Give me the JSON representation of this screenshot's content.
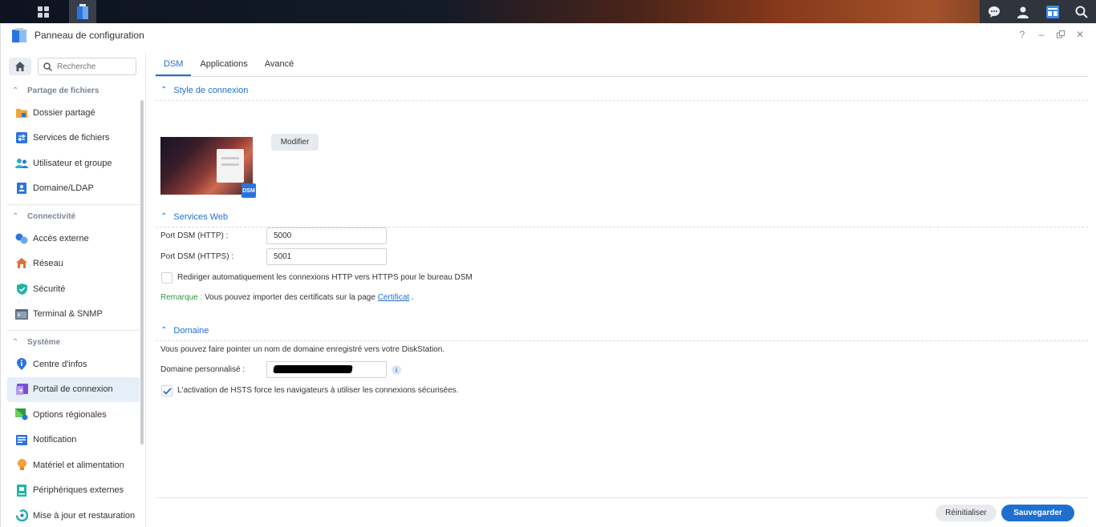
{
  "taskbar": {
    "left_icons": [
      "grid-icon",
      "control-panel-icon"
    ],
    "right_icons": [
      "chat-icon",
      "user-icon",
      "widgets-icon",
      "search-icon"
    ]
  },
  "window": {
    "title": "Panneau de configuration",
    "controls": [
      "?",
      "–",
      "□",
      "✕"
    ]
  },
  "sidebar": {
    "search_placeholder": "Recherche",
    "groups": [
      {
        "label": "Partage de fichiers",
        "items": [
          {
            "label": "Dossier partagé",
            "icon": "folder-share-icon",
            "color": "#f2a33a"
          },
          {
            "label": "Services de fichiers",
            "icon": "file-services-icon",
            "color": "#2b74e0"
          },
          {
            "label": "Utilisateur et groupe",
            "icon": "users-icon",
            "color": "#25b0c6"
          },
          {
            "label": "Domaine/LDAP",
            "icon": "domain-icon",
            "color": "#2b74e0"
          }
        ]
      },
      {
        "label": "Connectivité",
        "items": [
          {
            "label": "Accès externe",
            "icon": "external-access-icon",
            "color": "#2b74e0"
          },
          {
            "label": "Réseau",
            "icon": "network-icon",
            "color": "#e2703a"
          },
          {
            "label": "Sécurité",
            "icon": "shield-icon",
            "color": "#1fb5a6"
          },
          {
            "label": "Terminal & SNMP",
            "icon": "terminal-icon",
            "color": "#5a6a7d"
          }
        ]
      },
      {
        "label": "Système",
        "items": [
          {
            "label": "Centre d'infos",
            "icon": "info-center-icon",
            "color": "#2b74e0"
          },
          {
            "label": "Portail de connexion",
            "icon": "login-portal-icon",
            "color": "#7a4fd6",
            "selected": true
          },
          {
            "label": "Options régionales",
            "icon": "regional-icon",
            "color": "#2e9a3a"
          },
          {
            "label": "Notification",
            "icon": "notification-icon",
            "color": "#2b74e0"
          },
          {
            "label": "Matériel et alimentation",
            "icon": "bulb-icon",
            "color": "#f2a33a"
          },
          {
            "label": "Périphériques externes",
            "icon": "external-devices-icon",
            "color": "#1fb5a6"
          },
          {
            "label": "Mise à jour et restauration",
            "icon": "update-icon",
            "color": "#1fb5a6"
          }
        ]
      }
    ]
  },
  "tabs": [
    {
      "label": "DSM",
      "active": true
    },
    {
      "label": "Applications",
      "active": false
    },
    {
      "label": "Avancé",
      "active": false
    }
  ],
  "login_style": {
    "heading": "Style de connexion",
    "badge": "DSM",
    "modify_label": "Modifier"
  },
  "web_services": {
    "heading": "Services Web",
    "http_label": "Port DSM (HTTP) :",
    "http_value": "5000",
    "https_label": "Port DSM (HTTPS) :",
    "https_value": "5001",
    "redirect_label": "Rediriger automatiquement les connexions HTTP vers HTTPS pour le bureau DSM",
    "redirect_checked": false,
    "remark_prefix": "Remarque :",
    "remark_text": " Vous pouvez importer des certificats sur la page ",
    "remark_link": "Certificat",
    "remark_suffix": " ."
  },
  "domain": {
    "heading": "Domaine",
    "description": "Vous pouvez faire pointer un nom de domaine enregistré vers votre DiskStation.",
    "custom_label": "Domaine personnalisé :",
    "hsts_label": "L'activation de HSTS force les navigateurs à utiliser les connexions sécurisées.",
    "hsts_checked": true
  },
  "footer": {
    "reset_label": "Réinitialiser",
    "save_label": "Sauvegarder"
  },
  "colors": {
    "accent": "#1f6fd1",
    "remark_green": "#2e9a3a"
  }
}
